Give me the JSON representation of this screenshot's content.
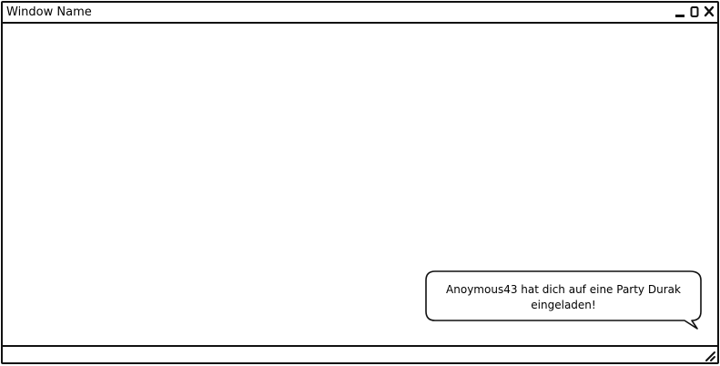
{
  "window": {
    "title": "Window Name",
    "controls": {
      "minimize_icon": "minimize-icon",
      "maximize_icon": "maximize-icon",
      "close_icon": "close-icon"
    }
  },
  "notification": {
    "message": "Anoymous43 hat dich auf eine Party Durak eingeladen!"
  },
  "statusbar": {
    "grip_icon": "resize-grip-icon"
  },
  "colors": {
    "stroke": "#111111",
    "background": "#ffffff"
  }
}
